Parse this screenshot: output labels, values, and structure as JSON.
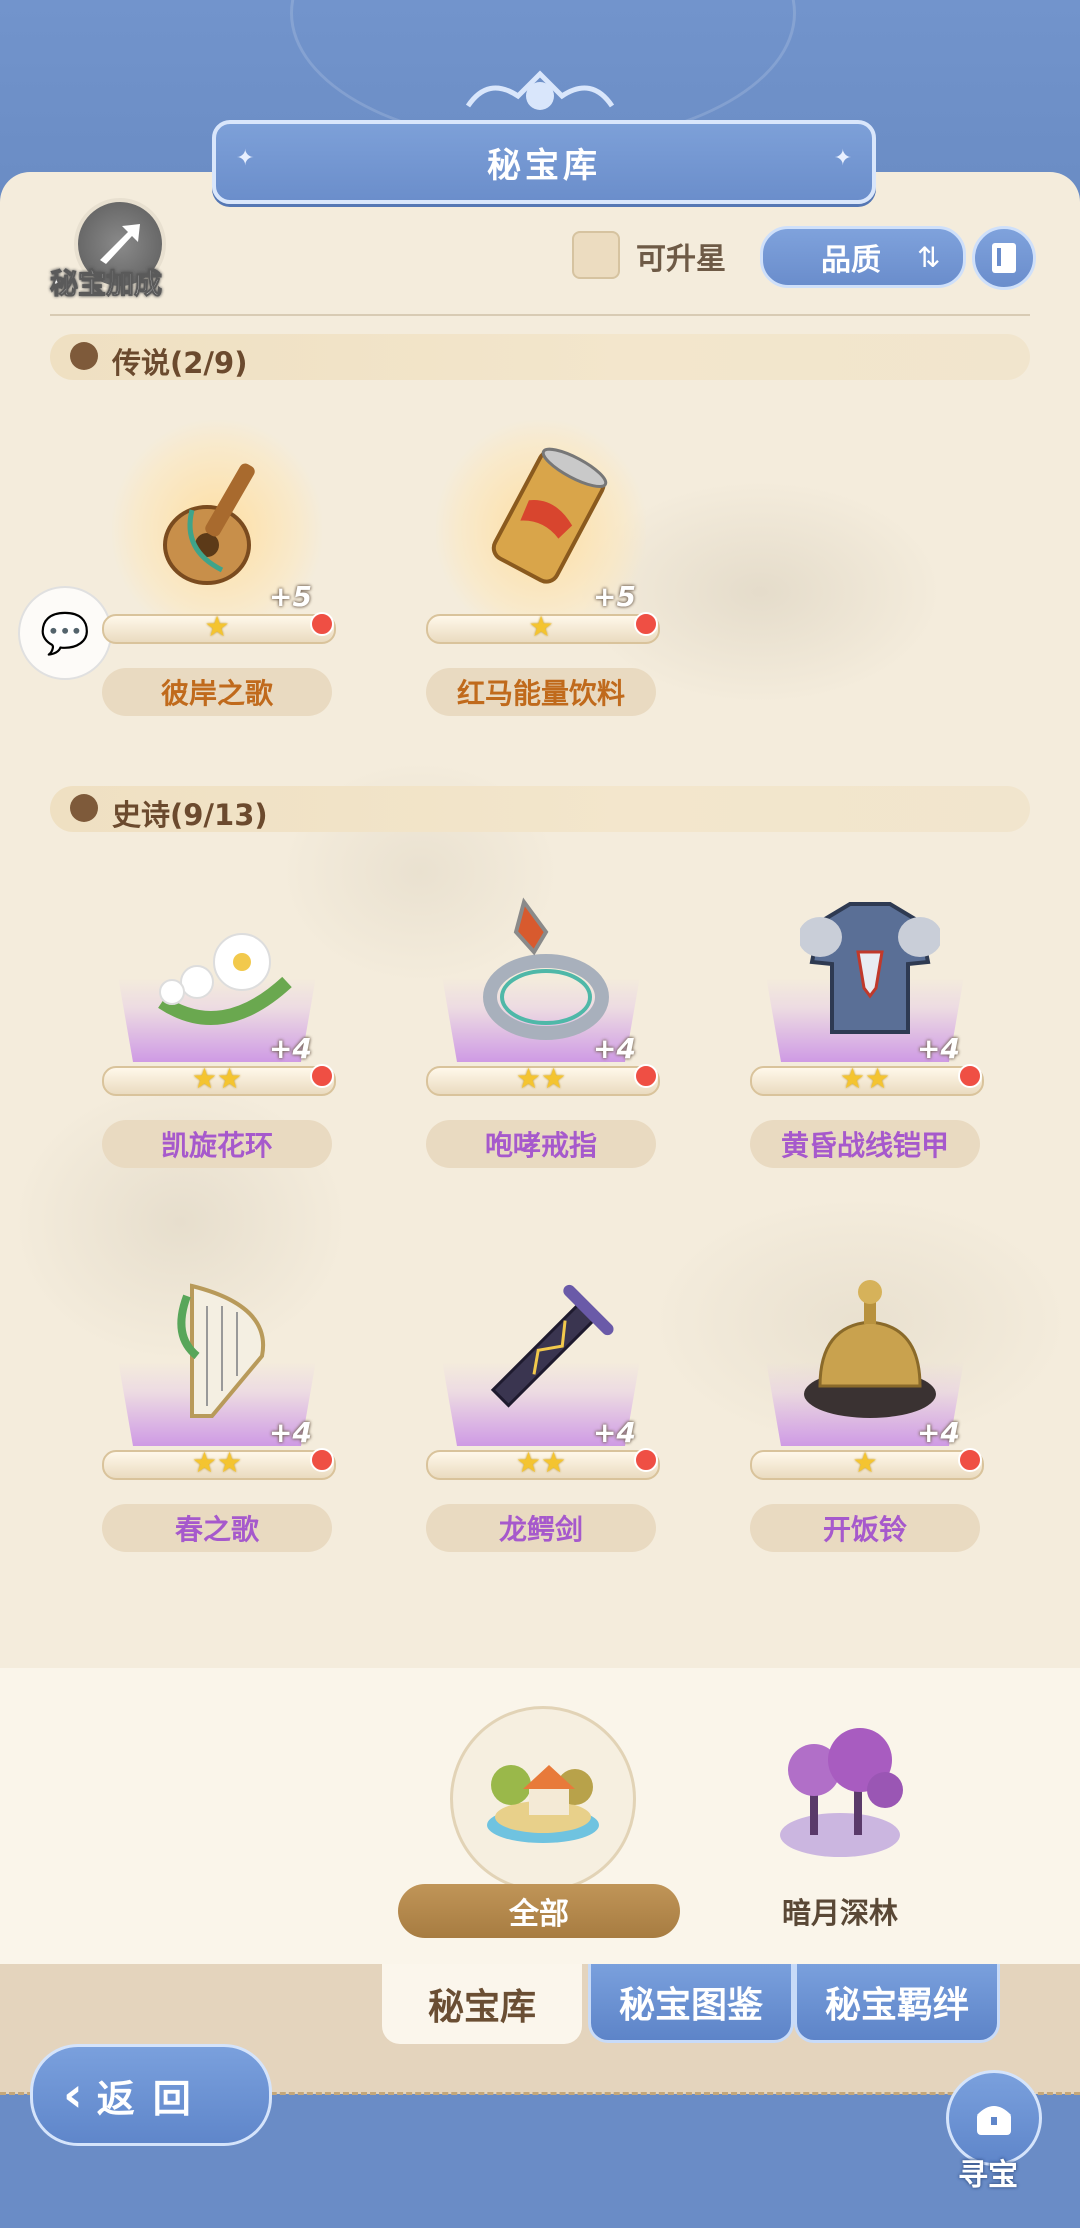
{
  "header": {
    "title": "秘宝库"
  },
  "toolbar": {
    "bonus_label": "秘宝加成",
    "upgradeable_label": "可升星",
    "sort_label": "品质",
    "sort_icon": "sort-arrows-icon",
    "info_icon": "book-icon"
  },
  "sections": [
    {
      "title": "传说(2/9)",
      "items": [
        {
          "name": "彼岸之歌",
          "level": "+5",
          "stars": "★",
          "icon": "lute-icon"
        },
        {
          "name": "红马能量饮料",
          "level": "+5",
          "stars": "★",
          "icon": "energy-drink-icon"
        }
      ]
    },
    {
      "title": "史诗(9/13)",
      "items": [
        {
          "name": "凯旋花环",
          "level": "+4",
          "stars": "★★",
          "icon": "flower-wreath-icon"
        },
        {
          "name": "咆哮戒指",
          "level": "+4",
          "stars": "★★",
          "icon": "ring-icon"
        },
        {
          "name": "黄昏战线铠甲",
          "level": "+4",
          "stars": "★★",
          "icon": "armor-icon"
        },
        {
          "name": "春之歌",
          "level": "+4",
          "stars": "★★",
          "icon": "harp-icon"
        },
        {
          "name": "龙鳄剑",
          "level": "+4",
          "stars": "★★",
          "icon": "sword-icon"
        },
        {
          "name": "开饭铃",
          "level": "+4",
          "stars": "★",
          "icon": "bell-icon"
        }
      ]
    }
  ],
  "filters": {
    "all": "全部",
    "dark_forest": "暗月深林"
  },
  "tabs": [
    "秘宝库",
    "秘宝图鉴",
    "秘宝羁绊"
  ],
  "footer": {
    "back_label": "返回",
    "treasure_label": "寻宝"
  },
  "colors": {
    "primary_blue": "#6a8cc6",
    "parchment": "#f4ecdc",
    "legend_name": "#c06a1c",
    "epic_name": "#a659cc",
    "notify_dot": "#ef4f44"
  }
}
